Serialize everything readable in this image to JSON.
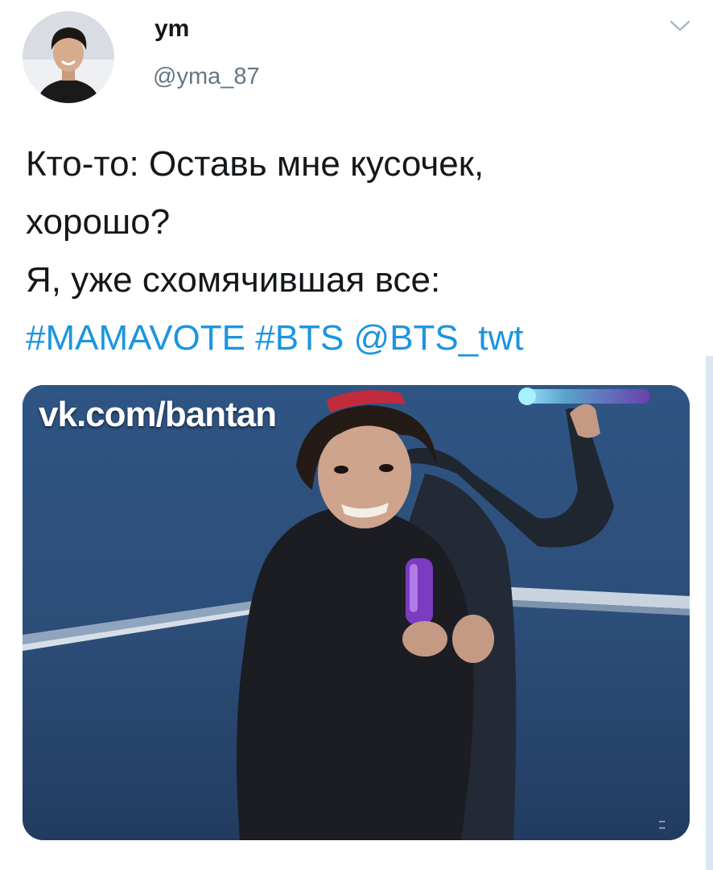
{
  "tweet": {
    "author": {
      "display_name": "ym",
      "handle": "@yma_87"
    },
    "text_lines": [
      "Кто-то: Оставь мне кусочек,",
      "хорошо?",
      "Я, уже схомячившая все:"
    ],
    "tags": [
      "#MAMAVOTE",
      "#BTS",
      "@BTS_twt"
    ],
    "media": {
      "watermark": "vk.com/bantan"
    },
    "menu_icon": "chevron-down-icon"
  },
  "colors": {
    "link": "#1b95e0",
    "text": "#14171a",
    "secondary": "#657786"
  }
}
